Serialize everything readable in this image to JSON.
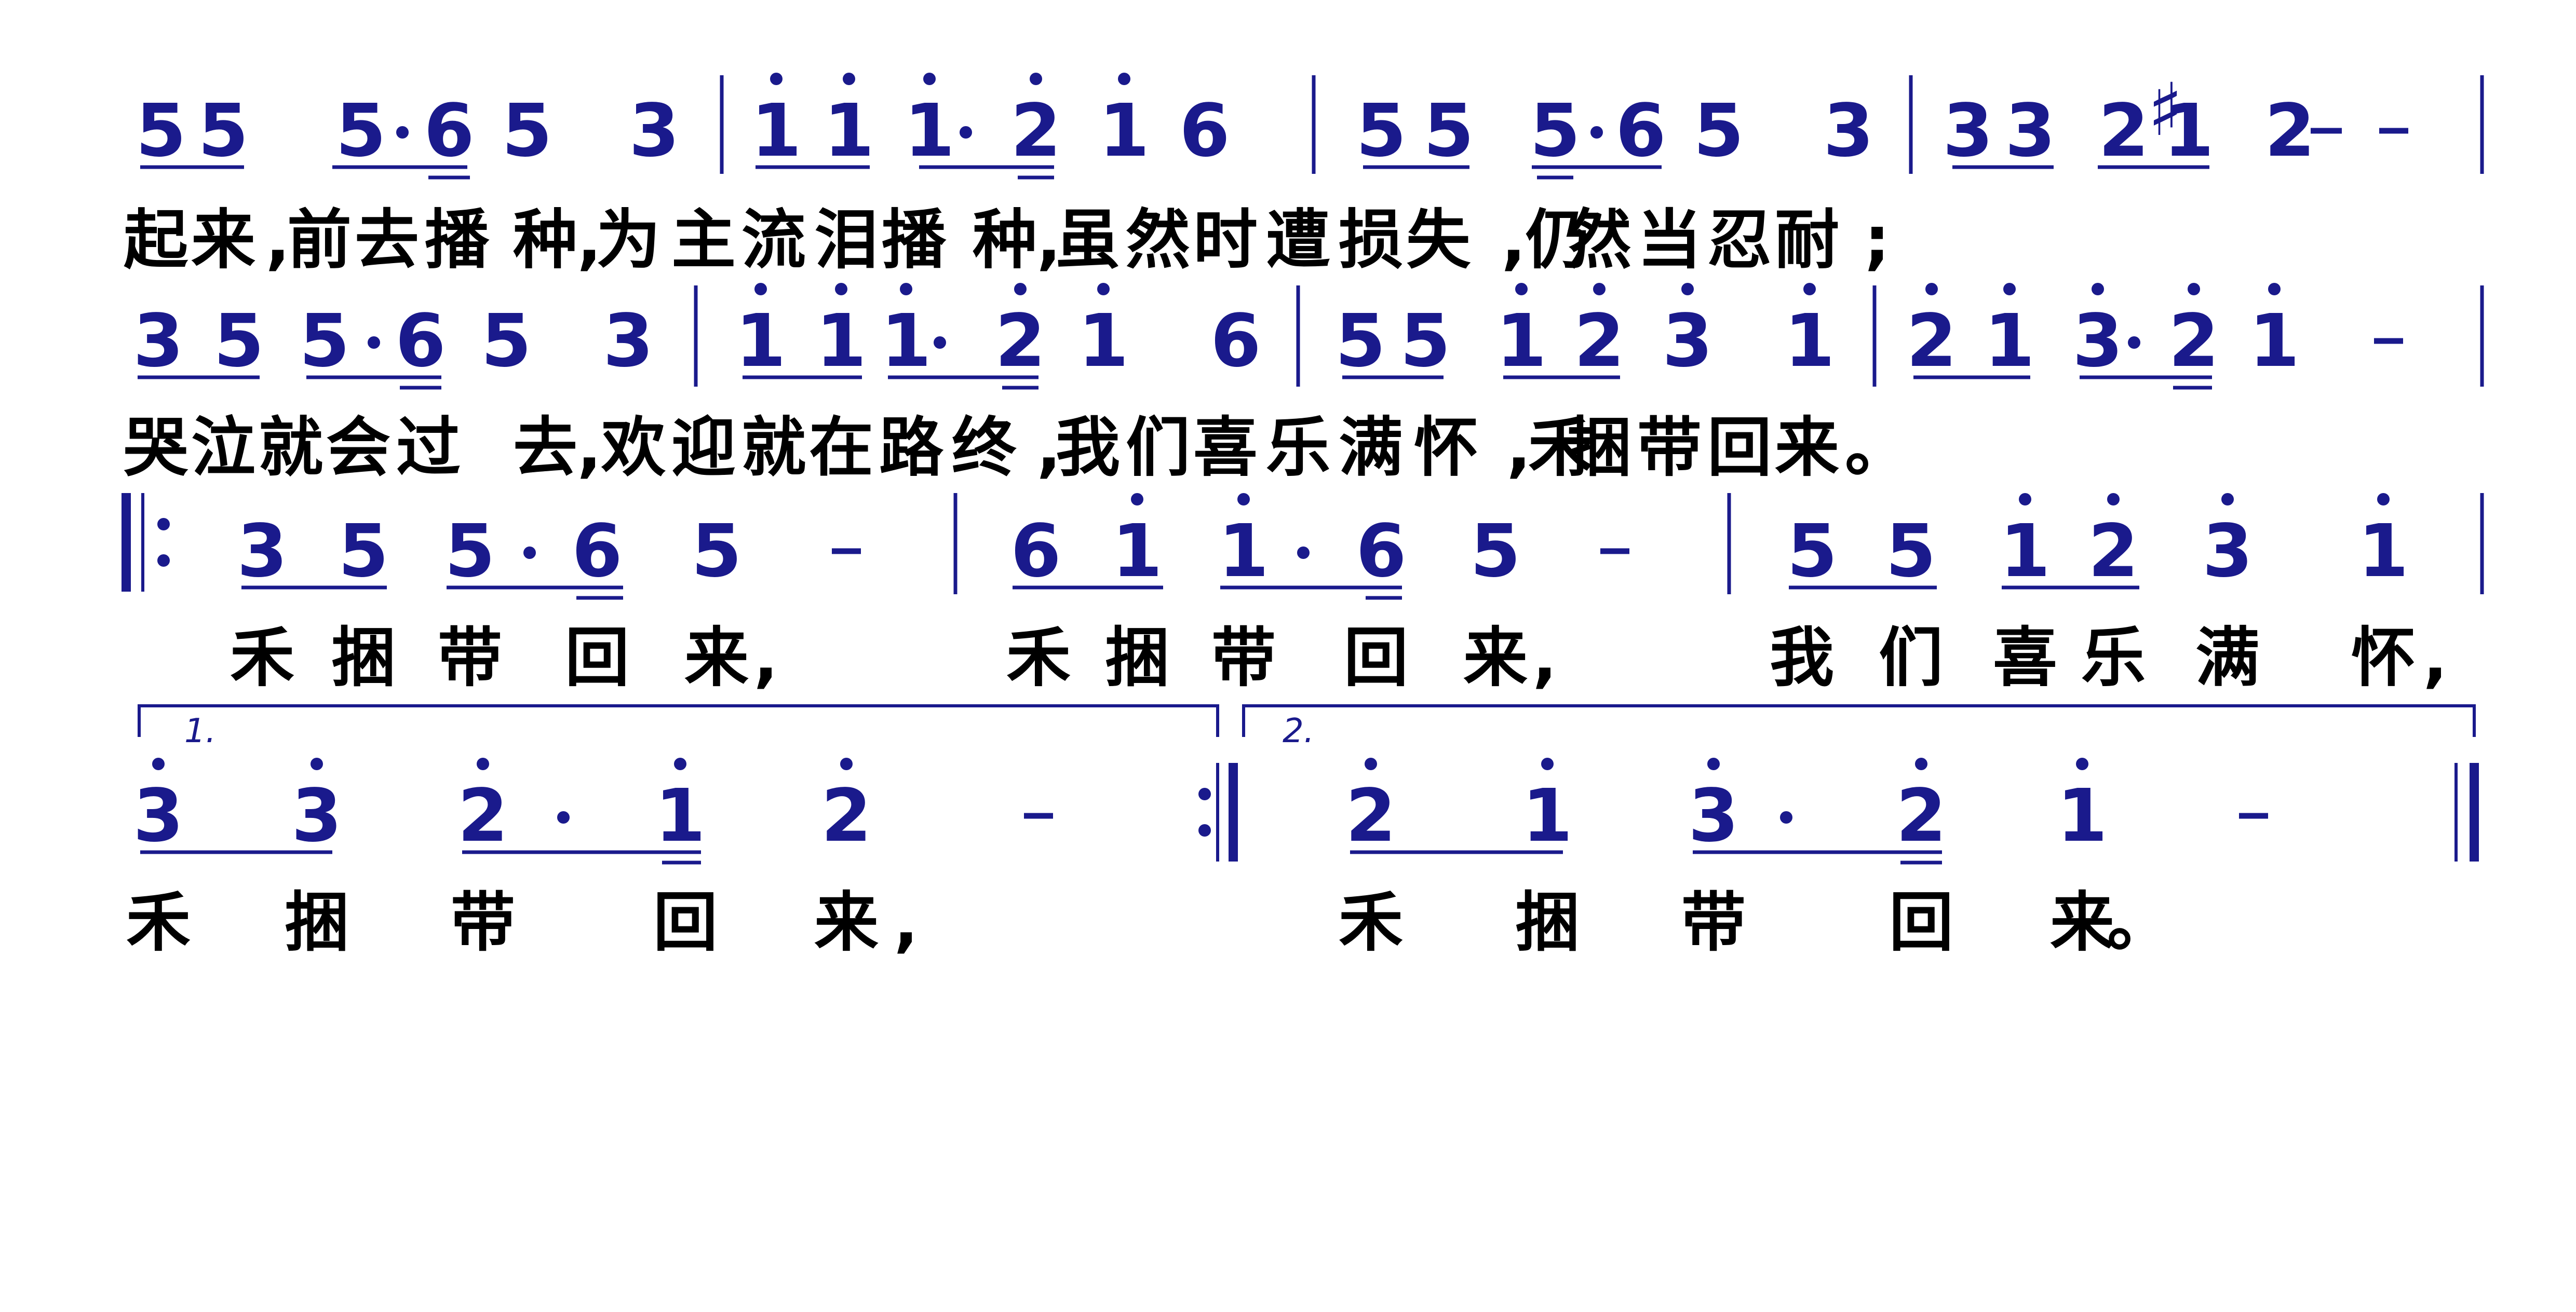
{
  "colors": {
    "notation": "#1a1a8c",
    "lyrics": "#000000"
  },
  "rows": [
    {
      "notes": [
        "5",
        "5",
        "5",
        "·",
        "6",
        "5",
        "3",
        "|",
        "1",
        "1",
        "1",
        "·",
        "2",
        "1",
        "6",
        "|",
        "5",
        "5",
        "5",
        "·",
        "6",
        "5",
        "3",
        "|",
        "3",
        "3",
        "2",
        "♯",
        "1",
        "2",
        "–",
        "|"
      ],
      "lyrics": [
        "起",
        "来",
        ",",
        "前",
        "去",
        "播",
        "种",
        ",",
        "为",
        "主",
        "流",
        "泪",
        "播",
        "种",
        ",",
        "虽",
        "然",
        "时",
        "遭",
        "损",
        "失",
        ",",
        "仍",
        "然",
        "当",
        "忍",
        "耐",
        ";"
      ]
    },
    {
      "notes": [
        "3",
        "5",
        "5",
        "·",
        "6",
        "5",
        "3",
        "|",
        "1",
        "1",
        "1",
        "·",
        "2",
        "1",
        "6",
        "|",
        "5",
        "5",
        "1",
        "2",
        "3",
        "1",
        "|",
        "2",
        "1",
        "3",
        "·",
        "2",
        "1",
        "–",
        "|"
      ],
      "lyrics": [
        "哭",
        "泣",
        "就",
        "会",
        "过",
        "去",
        ",",
        "欢",
        "迎",
        "就",
        "在",
        "路",
        "终",
        ",",
        "我",
        "们",
        "喜",
        "乐",
        "满",
        "怀",
        ",",
        "禾",
        "捆",
        "带",
        "回",
        "来",
        "。"
      ]
    },
    {
      "notes": [
        "3",
        "5",
        "5",
        "·",
        "6",
        "5",
        "–",
        "|",
        "6",
        "1",
        "1",
        "·",
        "6",
        "5",
        "–",
        "|",
        "5",
        "5",
        "1",
        "2",
        "3",
        "1",
        "|"
      ],
      "lyrics": [
        "禾",
        "捆",
        "带",
        "回",
        "来",
        ",",
        "禾",
        "捆",
        "带",
        "回",
        "来",
        ",",
        "我",
        "们",
        "喜",
        "乐",
        "满",
        "怀",
        ","
      ]
    },
    {
      "volta1": "1.",
      "volta2": "2.",
      "notes": [
        "3",
        "3",
        "2",
        "·",
        "1",
        "2",
        "–",
        "2",
        "1",
        "3",
        "·",
        "2",
        "1",
        "–"
      ],
      "lyrics": [
        "禾",
        "捆",
        "带",
        "回",
        "来",
        ",",
        "禾",
        "捆",
        "带",
        "回",
        "来",
        "。"
      ]
    }
  ]
}
